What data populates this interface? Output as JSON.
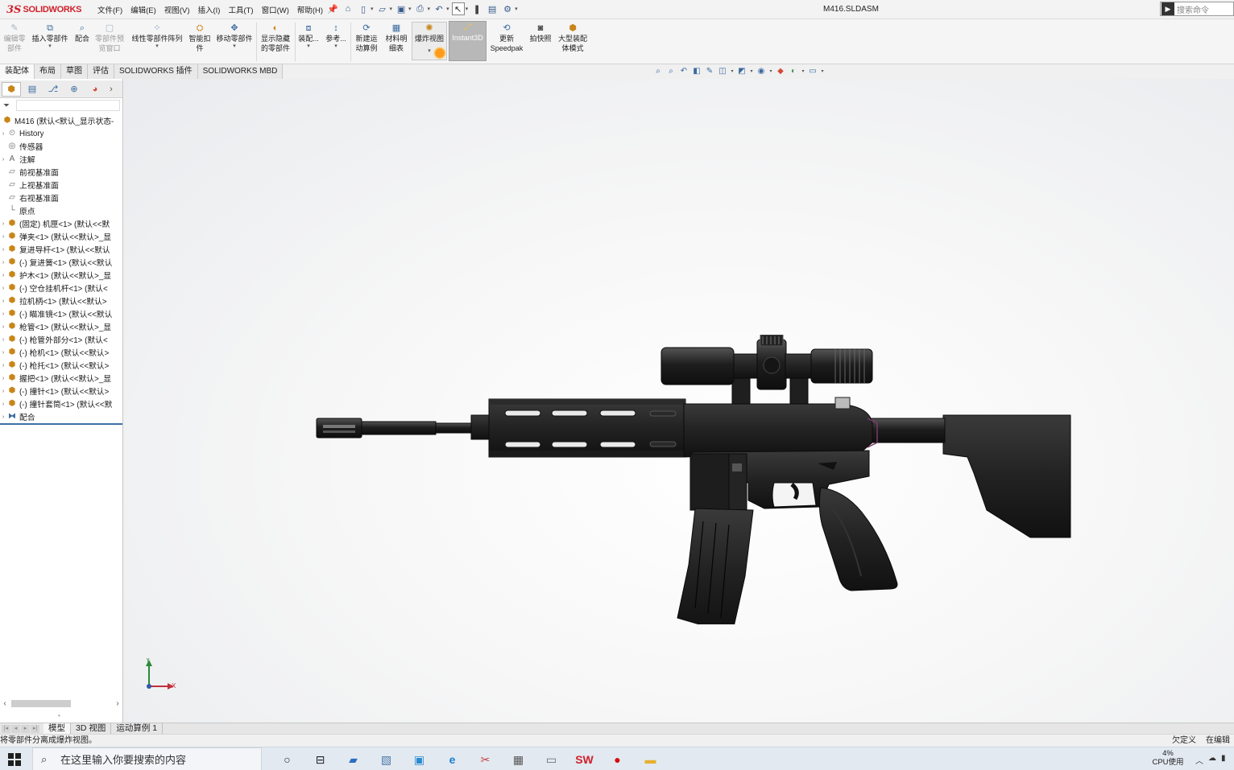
{
  "app": {
    "logo_mark": "3S",
    "logo_text": "SOLIDWORKS",
    "document_title": "M416.SLDASM",
    "search_placeholder": "搜索命令"
  },
  "menu": [
    "文件(F)",
    "编辑(E)",
    "视图(V)",
    "插入(I)",
    "工具(T)",
    "窗口(W)",
    "帮助(H)"
  ],
  "ribbon": {
    "edit_component": [
      "编辑零",
      "部件"
    ],
    "insert_components": [
      "插入零部件"
    ],
    "mate": [
      "配合"
    ],
    "component_preview": [
      "零部件预",
      "览窗口"
    ],
    "linear_pattern": [
      "线性零部件阵列"
    ],
    "smart_fasteners": [
      "智能扣",
      "件"
    ],
    "move_component": [
      "移动零部件"
    ],
    "show_hidden": [
      "显示隐藏",
      "的零部件"
    ],
    "assembly_features": [
      "装配..."
    ],
    "reference_geometry": [
      "参考..."
    ],
    "new_motion_study": [
      "新建运",
      "动算例"
    ],
    "bom": [
      "材料明",
      "细表"
    ],
    "exploded_view": [
      "爆炸视图"
    ],
    "instant3d": [
      "Instant3D"
    ],
    "update_speedpak": [
      "更新",
      "Speedpak"
    ],
    "snapshot": [
      "拍快照"
    ],
    "large_assembly": [
      "大型装配",
      "体模式"
    ]
  },
  "command_tabs": [
    "装配体",
    "布局",
    "草图",
    "评估",
    "SOLIDWORKS 插件",
    "SOLIDWORKS MBD"
  ],
  "tree": {
    "root": "M416 (默认<默认_显示状态-",
    "items": [
      {
        "label": "History",
        "icon": "history-icon",
        "expand": true
      },
      {
        "label": "传感器",
        "icon": "sensor-icon",
        "expand": false
      },
      {
        "label": "注解",
        "icon": "annotations-icon",
        "expand": true
      },
      {
        "label": "前视基准面",
        "icon": "plane-icon",
        "expand": false
      },
      {
        "label": "上视基准面",
        "icon": "plane-icon",
        "expand": false
      },
      {
        "label": "右视基准面",
        "icon": "plane-icon",
        "expand": false
      },
      {
        "label": "原点",
        "icon": "origin-icon",
        "expand": false
      },
      {
        "label": "(固定) 机匣<1> (默认<<默",
        "icon": "part-icon",
        "expand": true
      },
      {
        "label": "弹夹<1> (默认<<默认>_显",
        "icon": "part-icon",
        "expand": true
      },
      {
        "label": "复进导杆<1> (默认<<默认",
        "icon": "part-icon",
        "expand": true
      },
      {
        "label": "(-) 复进簧<1> (默认<<默认",
        "icon": "part-icon",
        "expand": true
      },
      {
        "label": "护木<1> (默认<<默认>_显",
        "icon": "part-icon",
        "expand": true
      },
      {
        "label": "(-) 空仓挂机杆<1> (默认<",
        "icon": "part-icon",
        "expand": true
      },
      {
        "label": "拉机柄<1> (默认<<默认>",
        "icon": "part-icon",
        "expand": true
      },
      {
        "label": "(-) 瞄准镜<1> (默认<<默认",
        "icon": "part-icon",
        "expand": true
      },
      {
        "label": "枪管<1> (默认<<默认>_显",
        "icon": "part-icon",
        "expand": true
      },
      {
        "label": "(-) 枪管外部分<1> (默认<",
        "icon": "part-icon",
        "expand": true
      },
      {
        "label": "(-) 枪机<1> (默认<<默认>",
        "icon": "part-icon",
        "expand": true
      },
      {
        "label": "(-) 枪托<1> (默认<<默认>",
        "icon": "part-icon",
        "expand": true
      },
      {
        "label": "握把<1> (默认<<默认>_显",
        "icon": "part-icon",
        "expand": true
      },
      {
        "label": "(-) 撞针<1> (默认<<默认>",
        "icon": "part-icon",
        "expand": true
      },
      {
        "label": "(-) 撞针套筒<1> (默认<<默",
        "icon": "part-icon",
        "expand": true
      },
      {
        "label": "配合",
        "icon": "mates-icon",
        "expand": true
      }
    ]
  },
  "triad": {
    "x_label": "X",
    "y_label": "Y"
  },
  "bottom_tabs": [
    "模型",
    "3D 视图",
    "运动算例 1"
  ],
  "status": {
    "message": "将零部件分离成爆炸视图。",
    "right1": "欠定义",
    "right2": "在编辑"
  },
  "taskbar": {
    "search_placeholder": "在这里输入你要搜索的内容",
    "cpu_percent": "4%",
    "cpu_label": "CPU使用"
  },
  "colors": {
    "brand": "#d0202a",
    "tree_accent": "#3f6fa8",
    "instant3d_active": "#b8b8b8",
    "model": "#1c1c1c"
  }
}
